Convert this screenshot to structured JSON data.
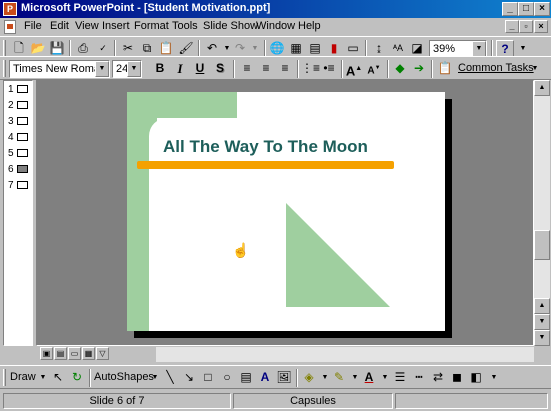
{
  "window": {
    "title": "Microsoft PowerPoint - [Student Motivation.ppt]"
  },
  "menu": [
    "File",
    "Edit",
    "View",
    "Insert",
    "Format",
    "Tools",
    "Slide Show",
    "Window",
    "Help"
  ],
  "standard_toolbar": {
    "zoom": "39%"
  },
  "formatting_toolbar": {
    "font": "Times New Roman",
    "size": "24",
    "bold": "B",
    "italic": "I",
    "underline": "U",
    "shadow": "S",
    "common_tasks": "Common Tasks"
  },
  "outline": {
    "slides": [
      "1",
      "2",
      "3",
      "4",
      "5",
      "6",
      "7"
    ],
    "active_index": 5
  },
  "slide": {
    "title": "All The Way To The Moon",
    "colors": {
      "green": "#9fcf9f",
      "title": "#1d5e5a",
      "orange": "#f5a100"
    }
  },
  "drawing_toolbar": {
    "draw": "Draw",
    "autoshapes": "AutoShapes"
  },
  "status": {
    "slide_position": "Slide 6 of 7",
    "design": "Capsules"
  }
}
